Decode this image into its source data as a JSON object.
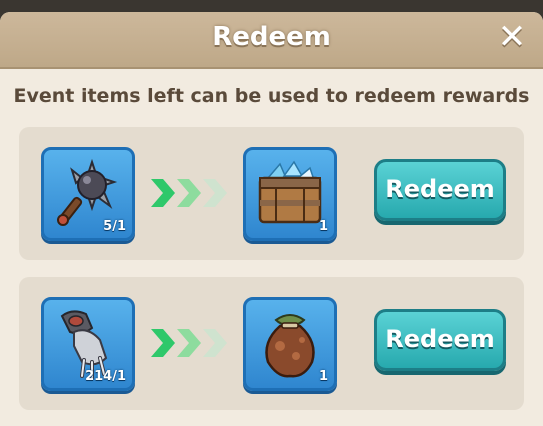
{
  "dialog": {
    "title": "Redeem",
    "close_icon": "close-icon",
    "description": "Event items left can be used to redeem rewards"
  },
  "rows": [
    {
      "source_icon": "spiked-mace-icon",
      "source_count": "5/1",
      "target_icon": "treasure-chest-icon",
      "target_count": "1",
      "button_label": "Redeem"
    },
    {
      "source_icon": "claw-paw-icon",
      "source_count": "214/1",
      "target_icon": "loot-sack-icon",
      "target_count": "1",
      "button_label": "Redeem"
    }
  ],
  "colors": {
    "button": "#2fb4b8",
    "slot": "#3f99dc",
    "arrow": "#2ec86a",
    "panel": "#f2ebe0"
  }
}
